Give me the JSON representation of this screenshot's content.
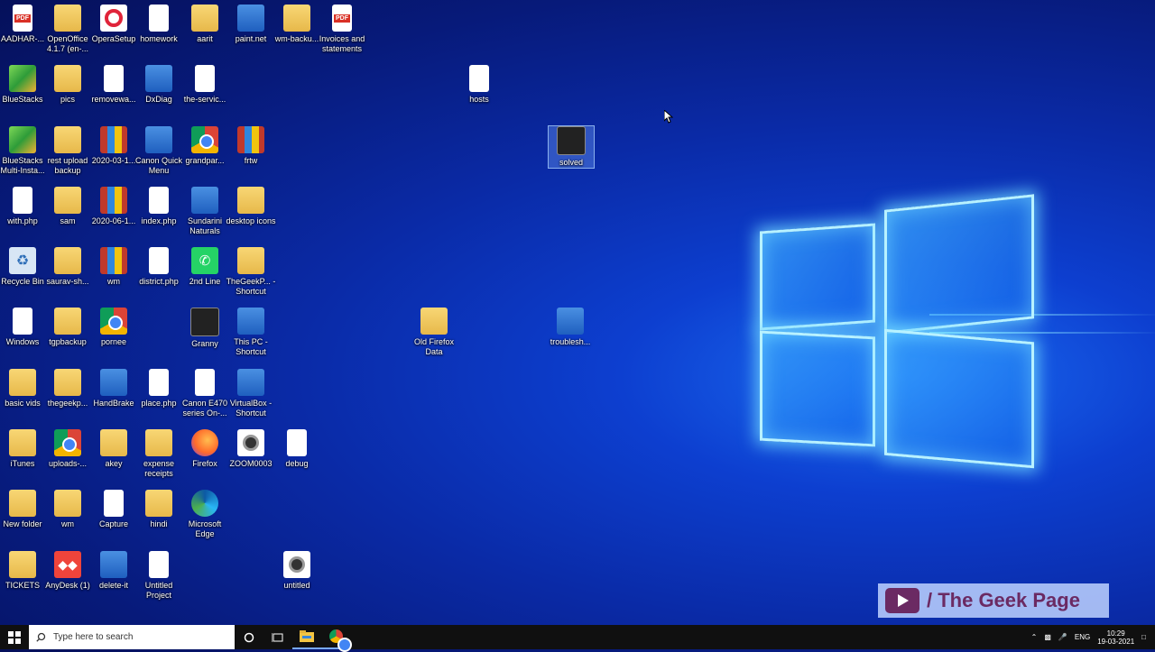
{
  "desktop": {
    "icons": [
      {
        "label": "AADHAR-...",
        "kind": "pdf"
      },
      {
        "label": "OpenOffice 4.1.7 (en-...",
        "kind": "folder"
      },
      {
        "label": "OperaSetup",
        "kind": "opera"
      },
      {
        "label": "homework",
        "kind": "file"
      },
      {
        "label": "aarit",
        "kind": "folder"
      },
      {
        "label": "paint.net",
        "kind": "app"
      },
      {
        "label": "wm-backu...",
        "kind": "folder"
      },
      {
        "label": "Invoices and statements",
        "kind": "pdf"
      },
      {
        "label": "BlueStacks",
        "kind": "bluestacks"
      },
      {
        "label": "pics",
        "kind": "folder"
      },
      {
        "label": "removewa...",
        "kind": "file"
      },
      {
        "label": "DxDiag",
        "kind": "app"
      },
      {
        "label": "the-servic...",
        "kind": "file"
      },
      {
        "label": "hosts",
        "kind": "file"
      },
      {
        "label": "BlueStacks Multi-Insta...",
        "kind": "bluestacks"
      },
      {
        "label": "rest upload backup",
        "kind": "folder"
      },
      {
        "label": "2020-03-1...",
        "kind": "zip"
      },
      {
        "label": "Canon Quick Menu",
        "kind": "app"
      },
      {
        "label": "grandpar...",
        "kind": "chrome"
      },
      {
        "label": "frtw",
        "kind": "zip"
      },
      {
        "label": "solved",
        "kind": "image"
      },
      {
        "label": "with.php",
        "kind": "file"
      },
      {
        "label": "sam",
        "kind": "folder"
      },
      {
        "label": "2020-06-1...",
        "kind": "zip"
      },
      {
        "label": "index.php",
        "kind": "file"
      },
      {
        "label": "Sundarini Naturals",
        "kind": "app"
      },
      {
        "label": "desktop icons",
        "kind": "folder"
      },
      {
        "label": "Recycle Bin",
        "kind": "recycle"
      },
      {
        "label": "saurav-sh...",
        "kind": "folder"
      },
      {
        "label": "wm",
        "kind": "zip"
      },
      {
        "label": "district.php",
        "kind": "file"
      },
      {
        "label": "2nd Line",
        "kind": "whatsapp"
      },
      {
        "label": "TheGeekP... - Shortcut",
        "kind": "folder"
      },
      {
        "label": "Windows",
        "kind": "file"
      },
      {
        "label": "tgpbackup",
        "kind": "folder"
      },
      {
        "label": "pornee",
        "kind": "chrome"
      },
      {
        "label": "Granny",
        "kind": "image"
      },
      {
        "label": "This PC - Shortcut",
        "kind": "app"
      },
      {
        "label": "Old Firefox Data",
        "kind": "folder"
      },
      {
        "label": "troublesh...",
        "kind": "app"
      },
      {
        "label": "basic vids",
        "kind": "folder"
      },
      {
        "label": "thegeekp...",
        "kind": "folder"
      },
      {
        "label": "HandBrake",
        "kind": "app"
      },
      {
        "label": "place.php",
        "kind": "file"
      },
      {
        "label": "Canon E470 series On-...",
        "kind": "file"
      },
      {
        "label": "VirtualBox - Shortcut",
        "kind": "app"
      },
      {
        "label": "iTunes",
        "kind": "folder"
      },
      {
        "label": "uploads-...",
        "kind": "chrome"
      },
      {
        "label": "akey",
        "kind": "folder"
      },
      {
        "label": "expense receipts",
        "kind": "folder"
      },
      {
        "label": "Firefox",
        "kind": "firefox"
      },
      {
        "label": "ZOOM0003",
        "kind": "media"
      },
      {
        "label": "debug",
        "kind": "file"
      },
      {
        "label": "New folder",
        "kind": "folder"
      },
      {
        "label": "wm",
        "kind": "folder"
      },
      {
        "label": "Capture",
        "kind": "file"
      },
      {
        "label": "hindi",
        "kind": "folder"
      },
      {
        "label": "Microsoft Edge",
        "kind": "edge"
      },
      {
        "label": "TICKETS",
        "kind": "folder"
      },
      {
        "label": "AnyDesk (1)",
        "kind": "anydesk"
      },
      {
        "label": "delete-it",
        "kind": "app"
      },
      {
        "label": "Untitled Project",
        "kind": "file"
      },
      {
        "label": "untitled",
        "kind": "media"
      }
    ]
  },
  "watermark": {
    "text": "/ The Geek Page"
  },
  "taskbar": {
    "search_placeholder": "Type here to search",
    "tray": {
      "language": "ENG",
      "time": "10:29",
      "date": "19-03-2021"
    }
  }
}
